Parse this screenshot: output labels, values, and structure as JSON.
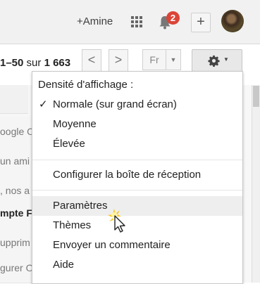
{
  "header": {
    "user_name": "+Amine",
    "notification_count": "2",
    "plus_symbol": "+"
  },
  "toolbar": {
    "pager": {
      "range": "1–50",
      "of": "sur",
      "total": "1 663"
    },
    "prev_symbol": "<",
    "next_symbol": ">",
    "language": "Fr"
  },
  "list_fragments": [
    {
      "text": "oogle O",
      "bold": false
    },
    {
      "text": "un ami",
      "bold": false
    },
    {
      "text": ", nos a",
      "bold": false
    },
    {
      "text": "mpte F",
      "bold": true
    },
    {
      "text": "upprim",
      "bold": false
    },
    {
      "text": "gurer O",
      "bold": false
    }
  ],
  "settings_menu": {
    "density_label": "Densité d'affichage :",
    "density_options": [
      {
        "label": "Normale (sur grand écran)",
        "checked": true
      },
      {
        "label": "Moyenne",
        "checked": false
      },
      {
        "label": "Élevée",
        "checked": false
      }
    ],
    "configure_inbox": "Configurer la boîte de réception",
    "items": [
      {
        "label": "Paramètres",
        "hovered": true
      },
      {
        "label": "Thèmes",
        "hovered": false
      },
      {
        "label": "Envoyer un commentaire",
        "hovered": false
      },
      {
        "label": "Aide",
        "hovered": false
      }
    ]
  },
  "icons": {
    "apps": "apps-grid-icon",
    "bell": "bell-icon",
    "gear": "gear-icon",
    "cursor": "mouse-pointer-icon",
    "check": "checkmark-icon"
  },
  "colors": {
    "badge": "#db4437",
    "hover_bg": "#eeeeee",
    "cursor_glow": "#f5c518"
  }
}
